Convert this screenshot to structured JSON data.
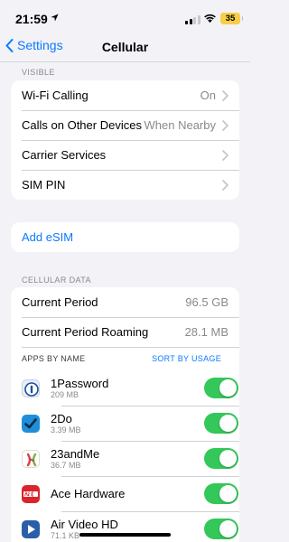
{
  "status_bar": {
    "time": "21:59",
    "battery_level": "35"
  },
  "nav": {
    "back_label": "Settings",
    "title": "Cellular"
  },
  "visible_header": "VISIBLE",
  "settings_rows": [
    {
      "label": "Wi-Fi Calling",
      "value": "On"
    },
    {
      "label": "Calls on Other Devices",
      "value": "When Nearby"
    },
    {
      "label": "Carrier Services",
      "value": ""
    },
    {
      "label": "SIM PIN",
      "value": ""
    }
  ],
  "add_esim_label": "Add eSIM",
  "cellular_data_header": "CELLULAR DATA",
  "usage": [
    {
      "label": "Current Period",
      "value": "96.5 GB"
    },
    {
      "label": "Current Period Roaming",
      "value": "28.1 MB"
    }
  ],
  "apps_header": {
    "by_name": "APPS BY NAME",
    "sort_label": "SORT BY USAGE"
  },
  "apps": [
    {
      "name": "1Password",
      "size": "209 MB",
      "enabled": true,
      "icon": "1password-icon"
    },
    {
      "name": "2Do",
      "size": "3.39 MB",
      "enabled": true,
      "icon": "2do-icon"
    },
    {
      "name": "23andMe",
      "size": "36.7 MB",
      "enabled": true,
      "icon": "23andme-icon"
    },
    {
      "name": "Ace Hardware",
      "size": "",
      "enabled": true,
      "icon": "ace-hardware-icon"
    },
    {
      "name": "Air Video HD",
      "size": "71.1 KB",
      "enabled": true,
      "icon": "air-video-hd-icon"
    }
  ],
  "colors": {
    "accent": "#0a7aff",
    "toggle_on": "#34c759",
    "battery": "#f7ce46",
    "background": "#f2f2f7"
  }
}
